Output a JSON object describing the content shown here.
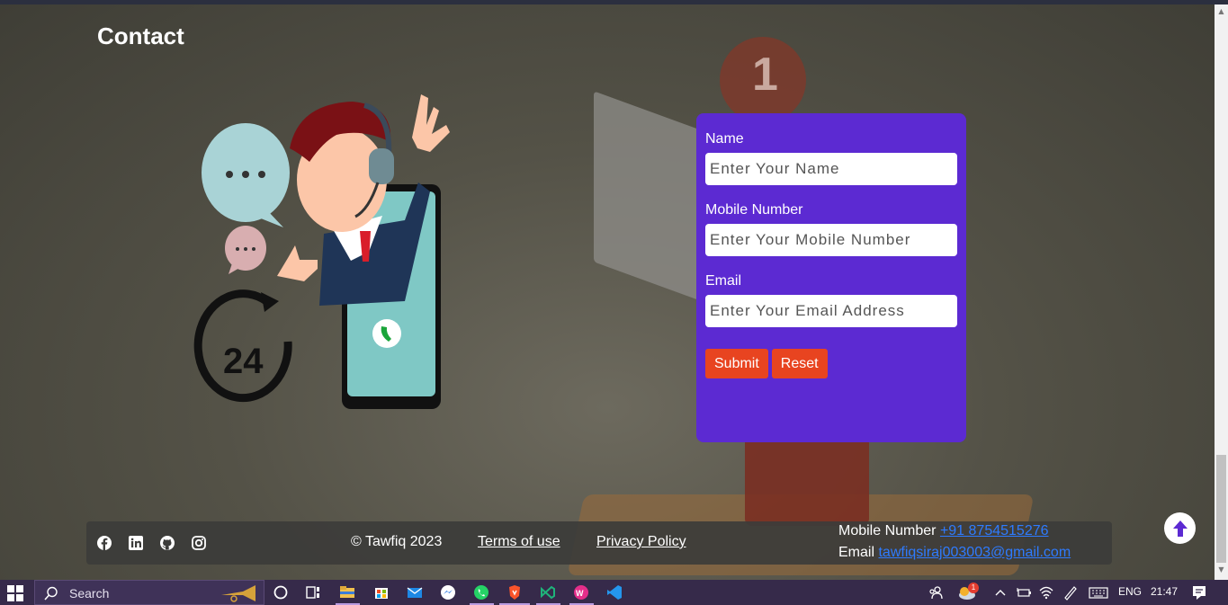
{
  "section": {
    "heading": "Contact"
  },
  "background": {
    "notification_count": "1"
  },
  "illustration": {
    "clock_text": "24"
  },
  "form": {
    "name_label": "Name",
    "name_placeholder": "Enter Your Name",
    "mobile_label": "Mobile Number",
    "mobile_placeholder": "Enter Your Mobile Number",
    "email_label": "Email",
    "email_placeholder": "Enter Your Email Address",
    "submit_label": "Submit",
    "reset_label": "Reset"
  },
  "footer": {
    "social_icons": [
      "facebook-icon",
      "linkedin-icon",
      "github-icon",
      "instagram-icon"
    ],
    "copyright": "© Tawfiq 2023",
    "terms_label": "Terms of use",
    "privacy_label": "Privacy Policy",
    "mobile_prefix": "Mobile Number",
    "mobile_value": "+91 8754515276",
    "email_prefix": "Email",
    "email_value": "tawfiqsiraj003003@gmail.com"
  },
  "taskbar": {
    "search_label": "Search",
    "language": "ENG",
    "time": "21:47",
    "weather_badge": "1"
  },
  "colors": {
    "form_bg": "#5c2ad2",
    "button_bg": "#e84420",
    "link": "#2e7bff"
  }
}
